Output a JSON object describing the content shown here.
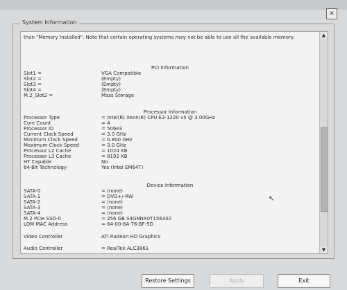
{
  "window": {
    "close_label": "×"
  },
  "panel": {
    "title": "System Information",
    "scroll_up_label": "▲",
    "scroll_down_label": "▼",
    "intro_text": "than \"Memory Installed\". Note that certain operating systems may not be able to use all the available memory."
  },
  "pci": {
    "title": "PCI Information",
    "rows": [
      {
        "label": "Slot1 =",
        "value": "VGA Compatible"
      },
      {
        "label": "Slot2 =",
        "value": "(Empty)"
      },
      {
        "label": "Slot3 =",
        "value": "(Empty)"
      },
      {
        "label": "Slot4 =",
        "value": "(Empty)"
      },
      {
        "label": "M.2_Slot2 =",
        "value": "Mass Storage"
      }
    ]
  },
  "processor": {
    "title": "Processor Information",
    "rows": [
      {
        "label": "Processor Type",
        "value": "= Intel(R) Xeon(R) CPU E3-1220 v5 @ 3.00GHz"
      },
      {
        "label": "Core Count",
        "value": "= 4"
      },
      {
        "label": "Processor ID",
        "value": "= 506e3"
      },
      {
        "label": "Current Clock Speed",
        "value": "= 3.0 GHz"
      },
      {
        "label": "Minimum Clock Speed",
        "value": "= 0.800 GHz"
      },
      {
        "label": "Maximum Clock Speed",
        "value": "= 3.0 GHz"
      },
      {
        "label": "Processor L2 Cache",
        "value": "= 1024 KB"
      },
      {
        "label": "Processor L3 Cache",
        "value": "= 8192 KB"
      },
      {
        "label": "HT Capable",
        "value": "No"
      },
      {
        "label": "64-Bit Technology",
        "value": "Yes (Intel EM64T)"
      }
    ]
  },
  "device": {
    "title": "Device Information",
    "rows": [
      {
        "label": "SATA-0",
        "value": "= (none)"
      },
      {
        "label": "SATA-1",
        "value": "= DVD+/-RW"
      },
      {
        "label": "SATA-2",
        "value": "= (none)"
      },
      {
        "label": "SATA-3",
        "value": "= (none)"
      },
      {
        "label": "SATA-4",
        "value": "= (none)"
      },
      {
        "label": "M.2 PCIe SSD-0",
        "value": "= 256 GB S4GNNX0T156302"
      },
      {
        "label": "LOM MAC Address",
        "value": "= 64-00-6A-76-BF-5D"
      },
      {
        "label": "Video Controller",
        "value": "ATI Radeon HD Graphics"
      },
      {
        "label": "Audio Controller",
        "value": "= RealTek ALC3861"
      }
    ]
  },
  "buttons": {
    "restore": "Restore Settings",
    "apply": "Apply",
    "exit": "Exit"
  }
}
